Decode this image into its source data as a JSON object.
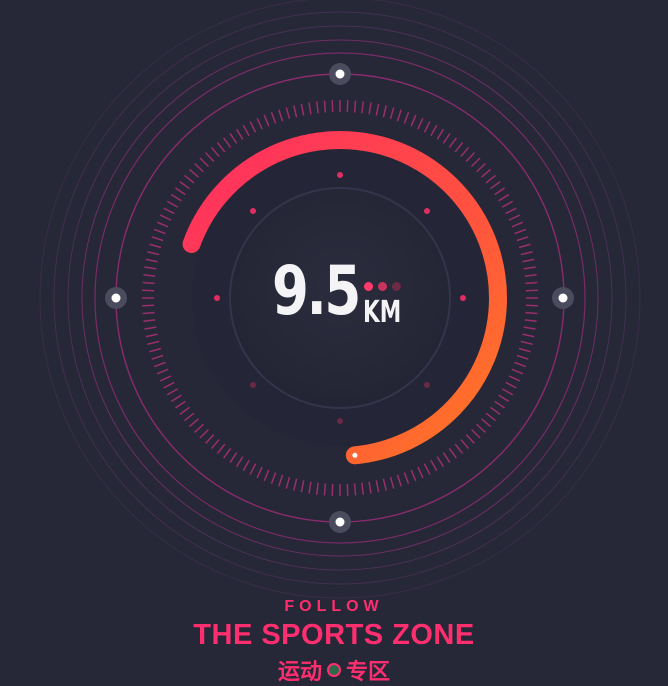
{
  "gauge": {
    "distance_value": "9.5",
    "distance_unit": "KM",
    "progress_fraction": 0.66,
    "colors": {
      "background": "#262737",
      "arc_start": "#ff2d63",
      "arc_end": "#ff7a22",
      "ring": "#a3307a",
      "node": "#ffffff"
    },
    "dot_indicators": [
      "#ff3b6b",
      "#c8345f",
      "#6c2a44"
    ]
  },
  "caption": {
    "follow": "FOLLOW",
    "title": "THE SPORTS ZONE",
    "cn_left": "运动",
    "cn_right": "专区"
  }
}
